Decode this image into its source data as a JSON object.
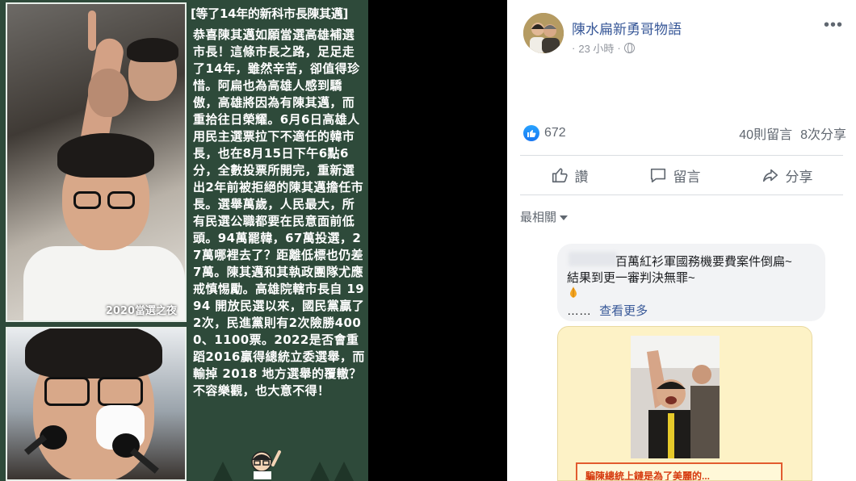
{
  "post_image": {
    "title": "[等了14年的新科市長陳其邁]",
    "body": "恭喜陳其邁如願當選高雄補選市長！這條市長之路，足足走了14年，雖然辛苦，卻值得珍惜。阿扁也為高雄人感到驕傲，高雄將因為有陳其邁，而重拾往日榮耀。6月6日高雄人用民主選票拉下不適任的韓市長，也在8月15日下午6點6分，全數投票所開完，重新選出2年前被拒絕的陳其邁擔任市長。選舉萬歲，人民最大，所有民選公職都要在民意面前低頭。94萬罷韓，67萬投選，27萬哪裡去了？距離低標也仍差7萬。陳其邁和其執政團隊尤應戒慎惕勵。高雄院轄市長自 1994 開放民選以來，國民黨贏了2次，民進黨則有2次險勝4000、1100票。2022是否會重蹈2016贏得總統立委選舉，而輸掉 2018 地方選舉的覆轍？不容樂觀，也大意不得！",
    "photo_caption": "2020當選之夜"
  },
  "post": {
    "page_name": "陳水扁新勇哥物語",
    "time": "23 小時",
    "separator": "·",
    "more_label": "•••",
    "like_count": "672",
    "comment_count": "40則留言",
    "share_count": "8次分享"
  },
  "actions": {
    "like": "讚",
    "comment": "留言",
    "share": "分享"
  },
  "comments": {
    "sort_label": "最相關",
    "first_comment": {
      "line1": "百萬紅衫軍國務機要費案件倒扁~",
      "line2": "結果到更一審判決無罪~",
      "see_more_dots": "……",
      "see_more": "查看更多"
    },
    "attached_caption": "騙陳總統上鏈是為了美麗的..."
  },
  "colors": {
    "fb_blue": "#1877f2",
    "link_blue": "#385898",
    "board_green": "#2e4a3a",
    "card_yellow": "#fdf2c6"
  },
  "icons": [
    "like-icon",
    "comment-icon",
    "share-icon",
    "globe-icon",
    "more-icon",
    "pray-icon",
    "caret-down-icon"
  ]
}
